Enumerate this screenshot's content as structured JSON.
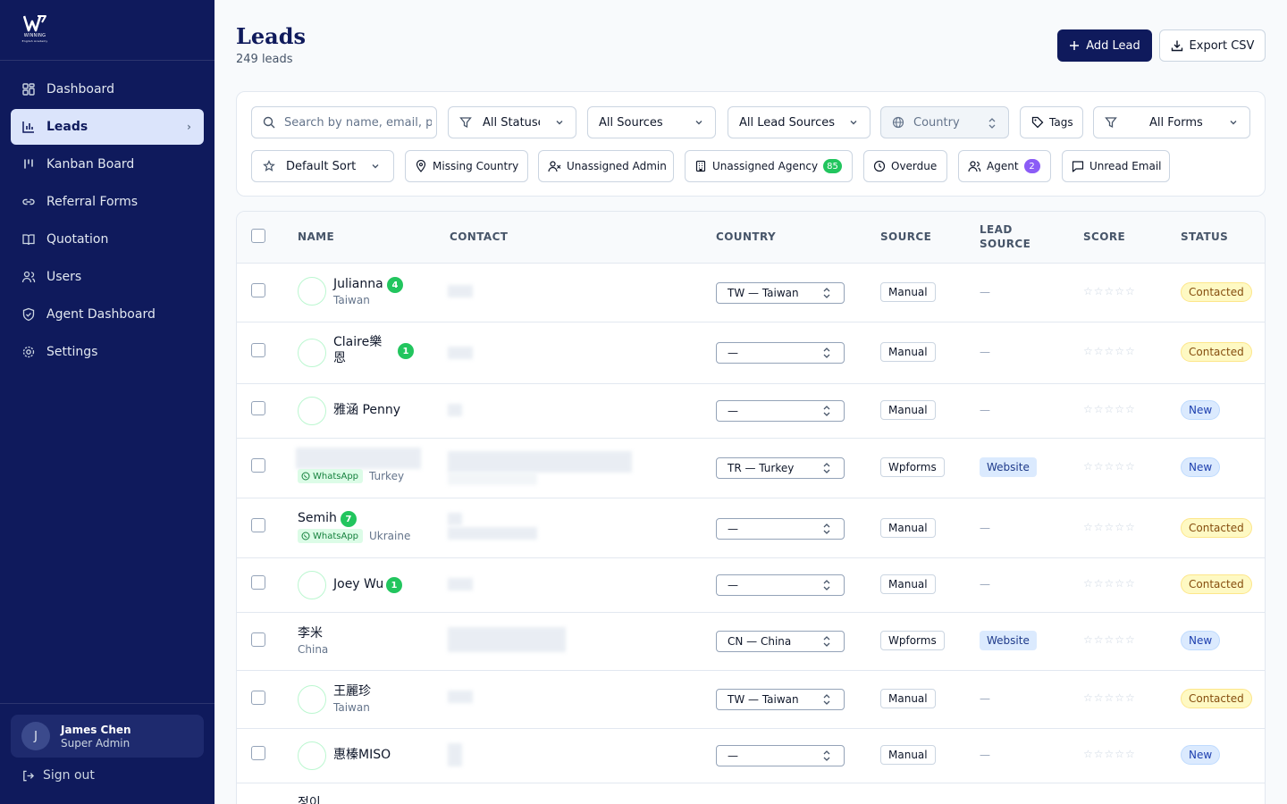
{
  "brand": {
    "logo_text": "WINNING",
    "logo_sub": "English Academy"
  },
  "nav": {
    "items": [
      {
        "label": "Dashboard",
        "icon": "grid-icon"
      },
      {
        "label": "Leads",
        "icon": "bar-chart-icon",
        "active": true
      },
      {
        "label": "Kanban Board",
        "icon": "kanban-icon"
      },
      {
        "label": "Referral Forms",
        "icon": "link-icon"
      },
      {
        "label": "Quotation",
        "icon": "book-icon"
      },
      {
        "label": "Users",
        "icon": "users-icon"
      },
      {
        "label": "Agent Dashboard",
        "icon": "shield-icon"
      },
      {
        "label": "Settings",
        "icon": "gear-icon"
      }
    ]
  },
  "user": {
    "initial": "J",
    "name": "James Chen",
    "role": "Super Admin",
    "sign_out": "Sign out"
  },
  "header": {
    "title": "Leads",
    "subtitle": "249 leads",
    "add_label": "Add Lead",
    "export_label": "Export CSV"
  },
  "filters": {
    "search_placeholder": "Search by name, email, phone...",
    "status": "All Statuses",
    "sources": "All Sources",
    "lead_sources": "All Lead Sources",
    "country": "Country",
    "tags": "Tags",
    "forms": "All Forms",
    "sort": "Default Sort",
    "chips": {
      "missing_country": "Missing Country",
      "unassigned_admin": "Unassigned Admin",
      "unassigned_agency": "Unassigned Agency",
      "unassigned_agency_count": "85",
      "overdue": "Overdue",
      "agent": "Agent",
      "agent_count": "2",
      "unread_email": "Unread Email"
    }
  },
  "table": {
    "columns": {
      "name": "NAME",
      "contact": "CONTACT",
      "country": "COUNTRY",
      "source": "SOURCE",
      "lead_source_1": "LEAD",
      "lead_source_2": "SOURCE",
      "score": "SCORE",
      "status": "STATUS"
    },
    "rows": [
      {
        "name": "Julianna",
        "sub": "Taiwan",
        "badge": "4",
        "country": "TW — Taiwan",
        "source": "Manual",
        "lead_source": "—",
        "stars": "☆☆☆☆☆",
        "status": "Contacted"
      },
      {
        "name_1": "Claire樂",
        "name_2": "恩",
        "badge": "1",
        "country": "—",
        "source": "Manual",
        "lead_source": "—",
        "stars": "☆☆☆☆☆",
        "status": "Contacted"
      },
      {
        "name": "雅涵 Penny",
        "country": "—",
        "source": "Manual",
        "lead_source": "—",
        "stars": "☆☆☆☆☆",
        "status": "New"
      },
      {
        "whatsapp": "WhatsApp",
        "sub": "Turkey",
        "country": "TR — Turkey",
        "source": "Wpforms",
        "lead_source": "Website",
        "stars": "☆☆☆☆☆",
        "status": "New"
      },
      {
        "name": "Semih",
        "badge": "7",
        "whatsapp": "WhatsApp",
        "sub": "Ukraine",
        "country": "—",
        "source": "Manual",
        "lead_source": "—",
        "stars": "☆☆☆☆☆",
        "status": "Contacted"
      },
      {
        "name": "Joey Wu",
        "badge": "1",
        "country": "—",
        "source": "Manual",
        "lead_source": "—",
        "stars": "☆☆☆☆☆",
        "status": "Contacted"
      },
      {
        "name": "李米",
        "sub": "China",
        "country": "CN — China",
        "source": "Wpforms",
        "lead_source": "Website",
        "stars": "☆☆☆☆☆",
        "status": "New"
      },
      {
        "name": "王麗珍",
        "sub": "Taiwan",
        "country": "TW — Taiwan",
        "source": "Manual",
        "lead_source": "—",
        "stars": "☆☆☆☆☆",
        "status": "Contacted"
      },
      {
        "name": "惠榛MISO",
        "country": "—",
        "source": "Manual",
        "lead_source": "—",
        "stars": "☆☆☆☆☆",
        "status": "New"
      },
      {
        "name": "정이"
      }
    ]
  },
  "colors": {
    "sidebar": "#0f1a5c",
    "accent": "#0f1a5c",
    "badge_green": "#22c55e",
    "badge_purple": "#8b5cf6"
  }
}
